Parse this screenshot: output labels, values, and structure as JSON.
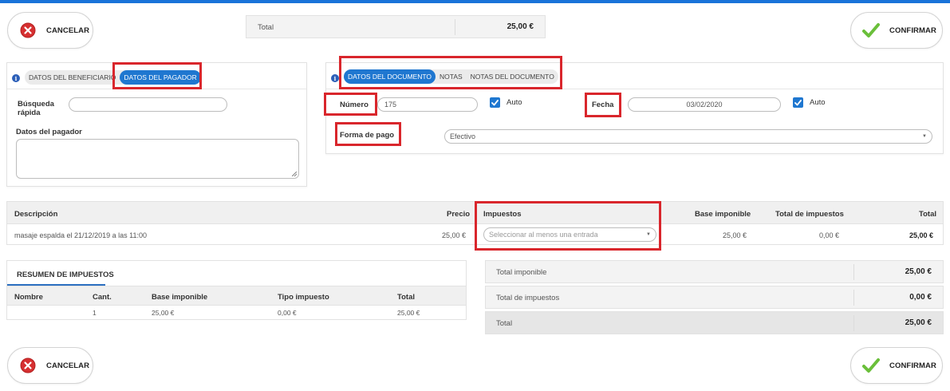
{
  "colors": {
    "accent": "#1f77d0",
    "highlight": "#d9262c",
    "cancel": "#d63031",
    "confirm": "#6abf3a"
  },
  "actions": {
    "cancel_label": "CANCELAR",
    "confirm_label": "CONFIRMAR",
    "cancel_icon": "cancel-icon",
    "confirm_icon": "check-icon"
  },
  "header": {
    "total_label": "Total",
    "total_value": "25,00 €"
  },
  "payer_panel": {
    "tabs": [
      "DATOS DEL BENEFICIARIO",
      "DATOS DEL PAGADOR"
    ],
    "active_tab": "DATOS DEL PAGADOR",
    "quick_search_label": "Búsqueda rápida",
    "quick_search_value": "",
    "payer_data_label": "Datos del pagador",
    "payer_data_value": ""
  },
  "document_panel": {
    "tabs": [
      "DATOS DEL DOCUMENTO",
      "NOTAS",
      "NOTAS DEL DOCUMENTO"
    ],
    "active_tab": "DATOS DEL DOCUMENTO",
    "number_label": "Número",
    "number_value": "175",
    "number_auto_label": "Auto",
    "number_auto_checked": true,
    "date_label": "Fecha",
    "date_value": "03/02/2020",
    "date_auto_label": "Auto",
    "date_auto_checked": true,
    "payment_label": "Forma de pago",
    "payment_value": "Efectivo"
  },
  "items_table": {
    "headers": [
      "Descripción",
      "Precio",
      "Impuestos",
      "Base imponible",
      "Total de impuestos",
      "Total"
    ],
    "rows": [
      {
        "description": "masaje espalda el 21/12/2019 a las 11:00",
        "price": "25,00 €",
        "tax_placeholder": "Seleccionar al menos una entrada",
        "base": "25,00 €",
        "tax_total": "0,00 €",
        "total": "25,00 €"
      }
    ]
  },
  "tax_summary": {
    "title": "RESUMEN DE IMPUESTOS",
    "headers": [
      "Nombre",
      "Cant.",
      "Base imponible",
      "Tipo impuesto",
      "Total"
    ],
    "rows": [
      {
        "name": "",
        "qty": "1",
        "base": "25,00 €",
        "type": "0,00 €",
        "total": "25,00 €"
      }
    ]
  },
  "totals": [
    {
      "label": "Total imponible",
      "value": "25,00 €"
    },
    {
      "label": "Total de impuestos",
      "value": "0,00 €"
    },
    {
      "label": "Total",
      "value": "25,00 €"
    }
  ]
}
